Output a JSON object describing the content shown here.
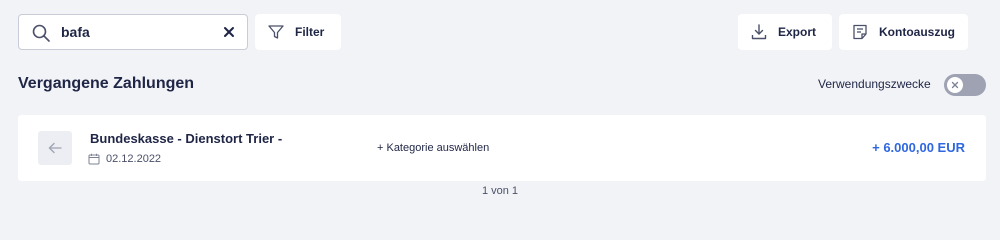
{
  "search": {
    "value": "bafa",
    "placeholder": ""
  },
  "toolbar": {
    "filter_label": "Filter",
    "export_label": "Export",
    "statement_label": "Kontoauszug"
  },
  "section": {
    "title": "Vergangene Zahlungen"
  },
  "toggle": {
    "label": "Verwendungszwecke",
    "enabled": false
  },
  "payments": [
    {
      "payee": "Bundeskasse - Dienstort Trier -",
      "date": "02.12.2022",
      "category_action": "+ Kategorie auswählen",
      "amount": "+ 6.000,00 EUR"
    }
  ],
  "pagination": {
    "text": "1 von 1"
  },
  "colors": {
    "background": "#f2f3f7",
    "text": "#1f2545",
    "accent": "#2f67e0",
    "toggle_off": "#9ea2b2"
  }
}
